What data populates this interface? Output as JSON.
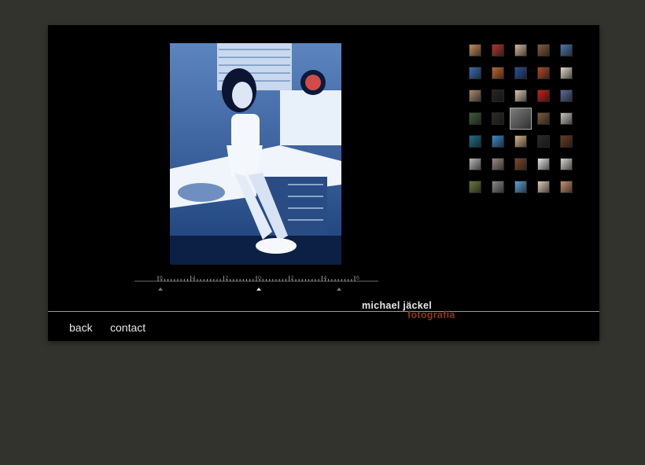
{
  "brand": {
    "name": "michael jäckel",
    "subtitle": "fotografía",
    "name_color": "#e8e8e8",
    "subtitle_color": "#8a3a12"
  },
  "nav": {
    "back_label": "back",
    "contact_label": "contact"
  },
  "slider": {
    "tick_labels": [
      "6",
      "4",
      "2",
      "0",
      "2",
      "4",
      "6"
    ],
    "markers": [
      "left-arrow",
      "center-arrow",
      "right-arrow"
    ]
  },
  "thumbnails": {
    "rows": 7,
    "cols": 5,
    "selected": {
      "row": 3,
      "col": 2
    },
    "tints": [
      [
        "#c98a5a",
        "#b3352a",
        "#d8b59b",
        "#8a5a3c",
        "#4a78b0"
      ],
      [
        "#3a6fb0",
        "#c0682a",
        "#2a4f9c",
        "#b04a28",
        "#e0d8c8"
      ],
      [
        "#a88a70",
        "#2a2420",
        "#d6c4b2",
        "#c82014",
        "#5a6a9c"
      ],
      [
        "#405c3a",
        "#2f2a26",
        "#7d7d7d",
        "#7a5a3a",
        "#c7c2bc"
      ],
      [
        "#1f6e8a",
        "#3a88c8",
        "#d4b58a",
        "#2a2a2a",
        "#6a3a22"
      ],
      [
        "#b8b8b8",
        "#9a8a80",
        "#7a4a2a",
        "#e8e4de",
        "#d8d4ce"
      ],
      [
        "#6a7a3a",
        "#8a8a8a",
        "#5ca0d8",
        "#e0c8b0",
        "#c89070"
      ]
    ]
  },
  "colors": {
    "page_bg": "#33332e",
    "panel_bg": "#000000",
    "accent": "#8a3a12"
  }
}
